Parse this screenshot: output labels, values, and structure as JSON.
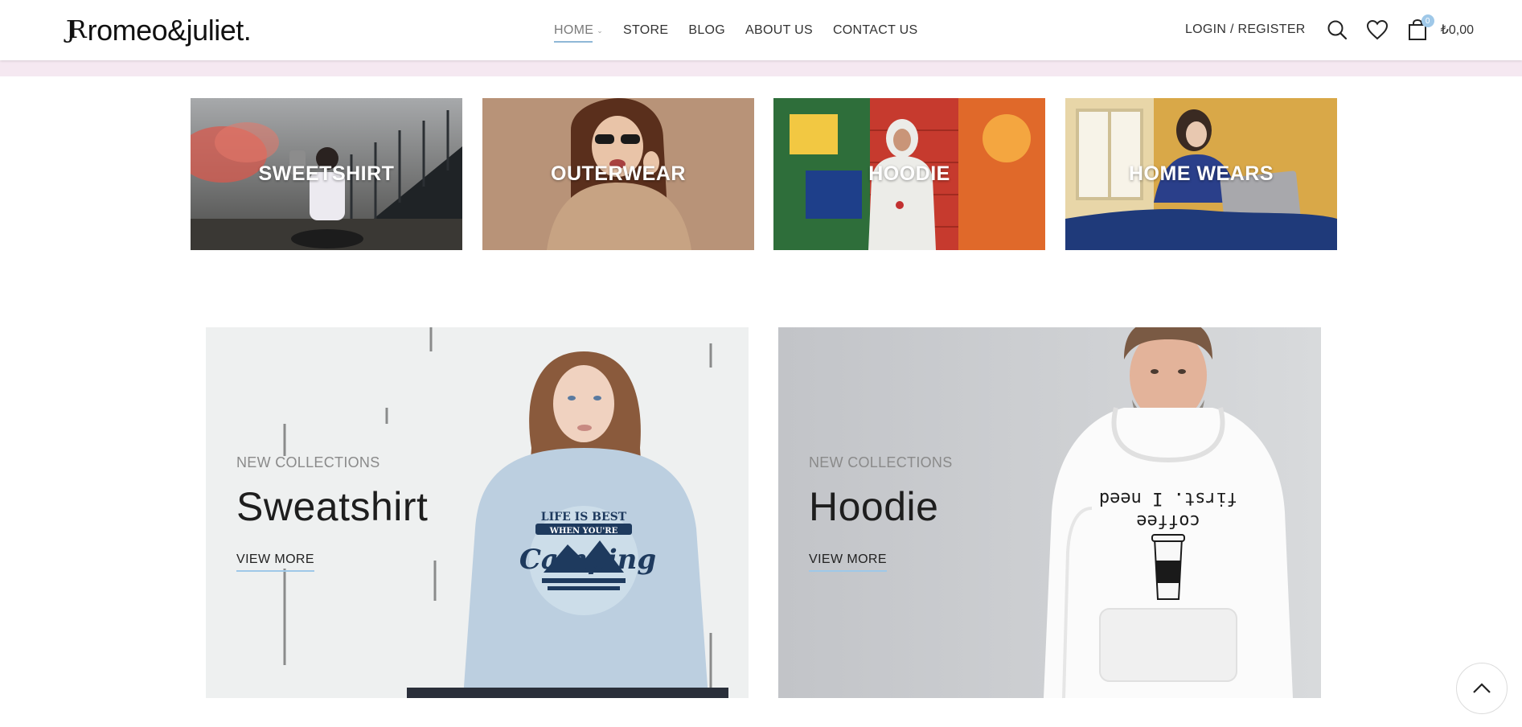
{
  "header": {
    "logo_mark": "JR",
    "logo_text": "romeo&juliet.",
    "nav": [
      {
        "label": "HOME",
        "active": true
      },
      {
        "label": "STORE"
      },
      {
        "label": "BLOG"
      },
      {
        "label": "ABOUT US"
      },
      {
        "label": "CONTACT US"
      }
    ],
    "login_label": "LOGIN / REGISTER",
    "cart_count": "0",
    "cart_total": "₺0,00"
  },
  "categories": [
    {
      "label": "SWEETSHIRT"
    },
    {
      "label": "OUTERWEAR"
    },
    {
      "label": "HOODIE"
    },
    {
      "label": "HOME WEARS"
    }
  ],
  "banners": [
    {
      "subtitle": "NEW COLLECTIONS",
      "title": "Sweatshirt",
      "link": "VIEW MORE",
      "print_text": [
        "LIFE IS BEST",
        "WHEN YOU'RE",
        "Camping"
      ]
    },
    {
      "subtitle": "NEW COLLECTIONS",
      "title": "Hoodie",
      "link": "VIEW MORE",
      "print_text": [
        "first. I need",
        "coffee"
      ]
    }
  ],
  "colors": {
    "accent": "#9fc8e8",
    "pink_strip": "#f5e8f1"
  }
}
